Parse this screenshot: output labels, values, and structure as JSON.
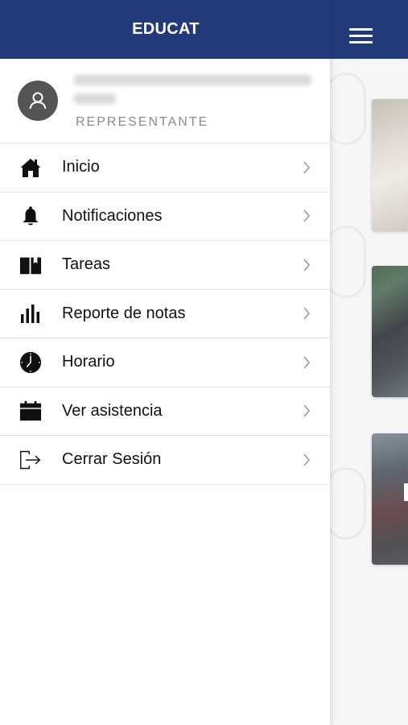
{
  "header": {
    "title": "EDUCAT"
  },
  "profile": {
    "role": "REPRESENTANTE"
  },
  "menu": {
    "items": [
      {
        "label": "Inicio",
        "icon": "home-icon"
      },
      {
        "label": "Notificaciones",
        "icon": "bell-icon"
      },
      {
        "label": "Tareas",
        "icon": "book-icon"
      },
      {
        "label": "Reporte de notas",
        "icon": "bar-chart-icon"
      },
      {
        "label": "Horario",
        "icon": "clock-icon"
      },
      {
        "label": "Ver asistencia",
        "icon": "calendar-icon"
      },
      {
        "label": "Cerrar Sesión",
        "icon": "logout-icon"
      }
    ]
  },
  "colors": {
    "header_bg": "#233a7a",
    "text": "#111111",
    "role_text": "#8a8a8a",
    "divider": "#e3e3e3"
  }
}
